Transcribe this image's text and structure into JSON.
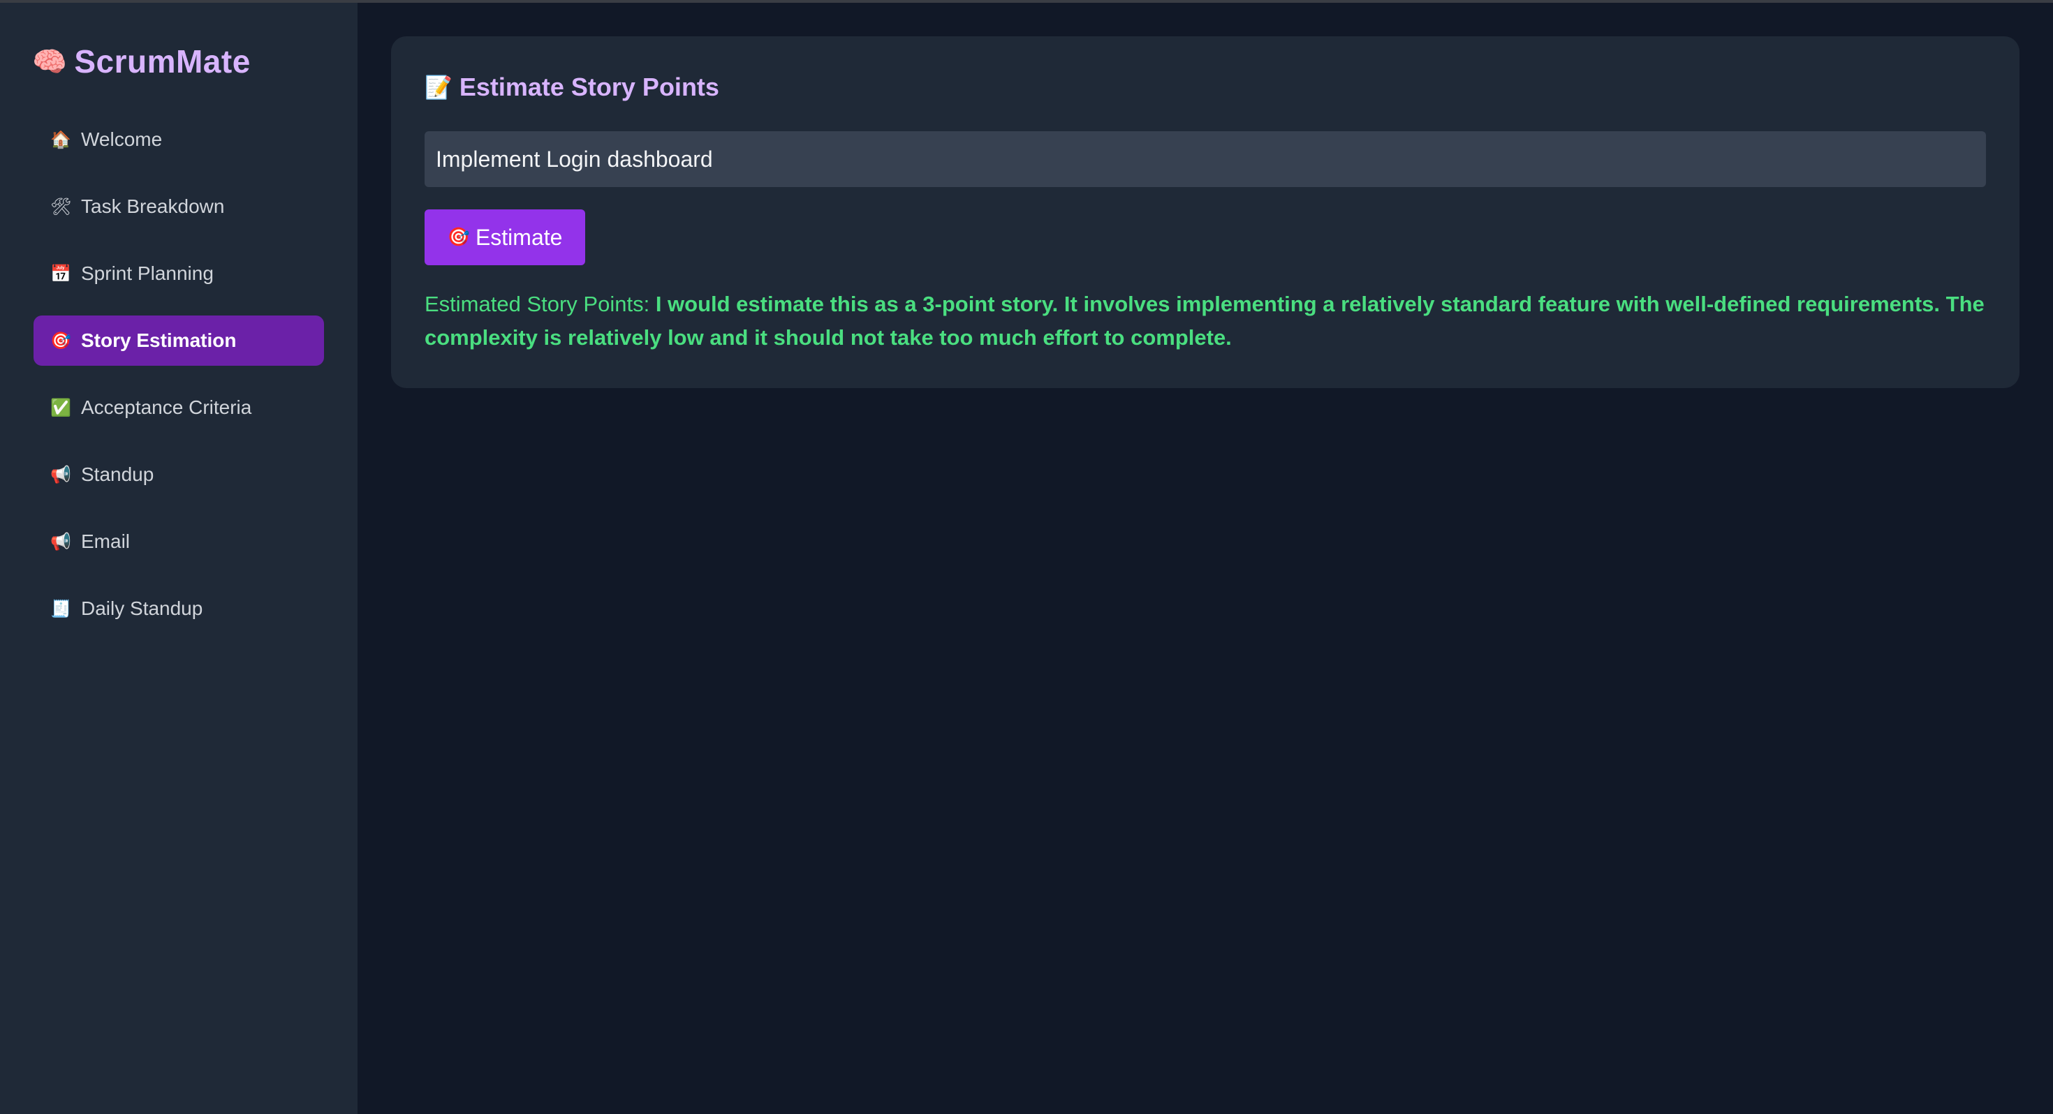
{
  "app": {
    "brand_icon": "🧠",
    "brand_name": "ScrumMate"
  },
  "sidebar": {
    "items": [
      {
        "icon": "🏠",
        "icon_name": "home-icon",
        "label": "Welcome",
        "active": false
      },
      {
        "icon": "🛠",
        "icon_name": "tools-icon",
        "label": "Task Breakdown",
        "active": false
      },
      {
        "icon": "📅",
        "icon_name": "calendar-icon",
        "label": "Sprint Planning",
        "active": false
      },
      {
        "icon": "🎯",
        "icon_name": "target-icon",
        "label": "Story Estimation",
        "active": true
      },
      {
        "icon": "✅",
        "icon_name": "check-icon",
        "label": "Acceptance Criteria",
        "active": false
      },
      {
        "icon": "📢",
        "icon_name": "megaphone-icon",
        "label": "Standup",
        "active": false
      },
      {
        "icon": "📢",
        "icon_name": "megaphone-icon",
        "label": "Email",
        "active": false
      },
      {
        "icon": "🧾",
        "icon_name": "receipt-icon",
        "label": "Daily Standup",
        "active": false
      }
    ]
  },
  "main": {
    "title_icon": "📝",
    "title": "Estimate Story Points",
    "input": {
      "value": "Implement Login dashboard",
      "placeholder": ""
    },
    "estimate_button": {
      "icon": "🎯",
      "label": "Estimate"
    },
    "result": {
      "label": "Estimated Story Points: ",
      "text": "I would estimate this as a 3-point story. It involves implementing a relatively standard feature with well-defined requirements. The complexity is relatively low and it should not take too much effort to complete."
    }
  },
  "colors": {
    "background": "#111827",
    "panel": "#1f2937",
    "accent": "#9333ea",
    "active_nav": "#6b21a8",
    "brand_text": "#d8b4fe",
    "success_text": "#4ade80"
  }
}
